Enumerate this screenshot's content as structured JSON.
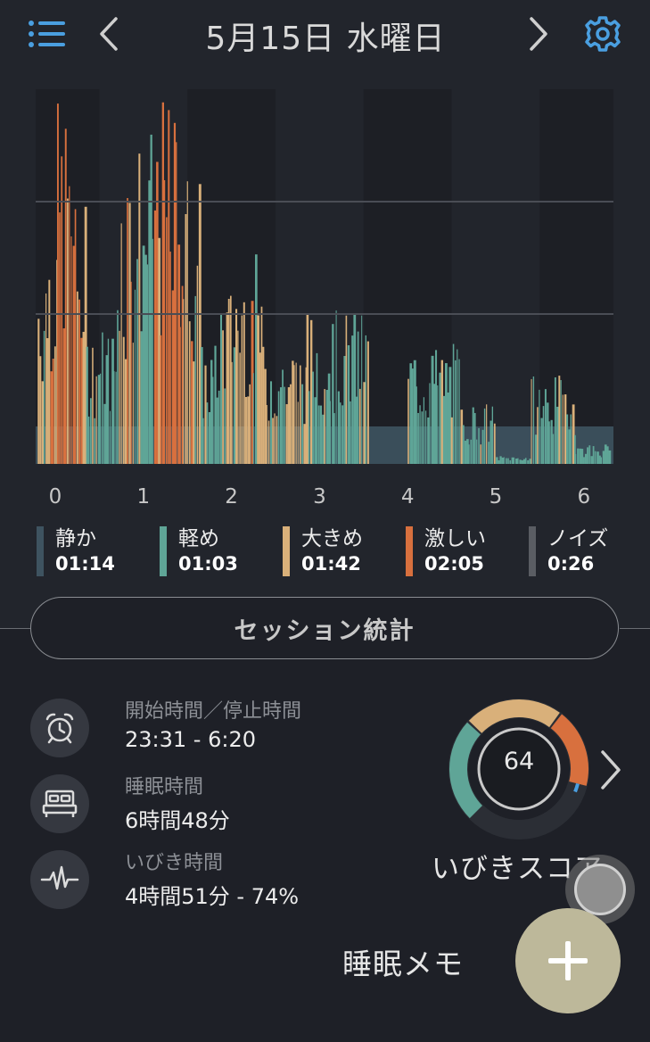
{
  "header": {
    "title": "5月15日 水曜日",
    "accent_color": "#4a9fe0",
    "icons": [
      "list-menu-icon",
      "chevron-left-icon",
      "chevron-right-icon",
      "gear-icon"
    ]
  },
  "colors": {
    "quiet": "#3e5360",
    "light": "#5fa597",
    "loud": "#d9b07a",
    "epic": "#d8703e",
    "noise": "#5a5d63"
  },
  "chart_data": {
    "type": "bar",
    "x_ticks": [
      "0",
      "1",
      "2",
      "3",
      "4",
      "5",
      "6"
    ],
    "xlim": [
      0,
      6.5
    ],
    "series": [
      {
        "name": "静か",
        "color": "#3e5360"
      },
      {
        "name": "軽め",
        "color": "#5fa597"
      },
      {
        "name": "大きめ",
        "color": "#d9b07a"
      },
      {
        "name": "激しい",
        "color": "#d8703e"
      }
    ],
    "segments": [
      {
        "start": 0.0,
        "end": 0.1,
        "level": 0.55,
        "mix": "loud"
      },
      {
        "start": 0.1,
        "end": 0.22,
        "level": 0.65,
        "mix": "loud"
      },
      {
        "start": 0.22,
        "end": 0.42,
        "level": 0.9,
        "mix": "epic"
      },
      {
        "start": 0.42,
        "end": 0.55,
        "level": 0.65,
        "mix": "epic"
      },
      {
        "start": 0.55,
        "end": 0.9,
        "level": 0.35,
        "mix": "light"
      },
      {
        "start": 0.9,
        "end": 1.1,
        "level": 0.8,
        "mix": "loud"
      },
      {
        "start": 1.1,
        "end": 1.3,
        "level": 0.82,
        "mix": "mixed"
      },
      {
        "start": 1.3,
        "end": 1.65,
        "level": 0.9,
        "mix": "epic"
      },
      {
        "start": 1.65,
        "end": 1.85,
        "level": 0.75,
        "mix": "loud"
      },
      {
        "start": 1.85,
        "end": 2.05,
        "level": 0.3,
        "mix": "light"
      },
      {
        "start": 2.05,
        "end": 2.2,
        "level": 0.45,
        "mix": "mixed"
      },
      {
        "start": 2.2,
        "end": 2.55,
        "level": 0.52,
        "mix": "loud"
      },
      {
        "start": 2.55,
        "end": 3.05,
        "level": 0.3,
        "mix": "mixed"
      },
      {
        "start": 3.05,
        "end": 3.75,
        "level": 0.38,
        "mix": "light"
      },
      {
        "start": 3.75,
        "end": 4.2,
        "level": 0.0,
        "mix": "quiet"
      },
      {
        "start": 4.2,
        "end": 4.8,
        "level": 0.3,
        "mix": "light"
      },
      {
        "start": 4.8,
        "end": 5.2,
        "level": 0.15,
        "mix": "light"
      },
      {
        "start": 5.2,
        "end": 5.6,
        "level": 0.02,
        "mix": "quiet"
      },
      {
        "start": 5.6,
        "end": 6.1,
        "level": 0.22,
        "mix": "light"
      },
      {
        "start": 6.1,
        "end": 6.5,
        "level": 0.05,
        "mix": "quiet"
      }
    ]
  },
  "legend": [
    {
      "name": "静か",
      "duration": "01:14",
      "color": "#3e5360"
    },
    {
      "name": "軽め",
      "duration": "01:03",
      "color": "#5fa597"
    },
    {
      "name": "大きめ",
      "duration": "01:42",
      "color": "#d9b07a"
    },
    {
      "name": "激しい",
      "duration": "02:05",
      "color": "#d8703e"
    },
    {
      "name": "ノイズ",
      "duration": "0:26",
      "color": "#5a5d63"
    }
  ],
  "session_button": "セッション統計",
  "stats": {
    "start_stop": {
      "label": "開始時間／停止時間",
      "value": "23:31 - 6:20",
      "icon": "alarm-clock-icon"
    },
    "sleep": {
      "label": "睡眠時間",
      "value": "6時間48分",
      "icon": "bed-icon"
    },
    "snore": {
      "label": "いびき時間",
      "value": "4時間51分 - 74%",
      "icon": "waveform-icon"
    }
  },
  "score": {
    "value": "64",
    "label": "いびきスコア",
    "icon": "chevron-right-icon"
  },
  "memo": {
    "label": "睡眠メモ",
    "add_icon": "plus-icon",
    "fab_color": "#bdb89a"
  }
}
